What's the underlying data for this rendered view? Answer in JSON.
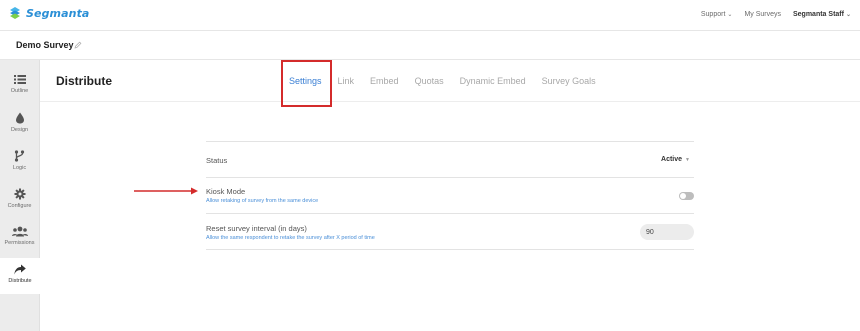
{
  "brand": {
    "name": "Segmanta",
    "accent": "#2b8fd6"
  },
  "topnav": {
    "support": "Support",
    "my_surveys": "My Surveys",
    "user": "Segmanta Staff"
  },
  "survey": {
    "title": "Demo Survey"
  },
  "sidebar": {
    "items": [
      {
        "label": "Outline",
        "icon": "list-icon"
      },
      {
        "label": "Design",
        "icon": "droplet-icon"
      },
      {
        "label": "Logic",
        "icon": "branch-icon"
      },
      {
        "label": "Configure",
        "icon": "gear-icon"
      },
      {
        "label": "Permissions",
        "icon": "users-icon"
      },
      {
        "label": "Distribute",
        "icon": "share-arrow-icon",
        "active": true
      }
    ]
  },
  "main": {
    "title": "Distribute",
    "tabs": [
      {
        "label": "Settings",
        "active": true
      },
      {
        "label": "Link"
      },
      {
        "label": "Embed"
      },
      {
        "label": "Quotas"
      },
      {
        "label": "Dynamic Embed"
      },
      {
        "label": "Survey Goals"
      }
    ]
  },
  "settings": {
    "status": {
      "label": "Status",
      "value": "Active"
    },
    "kiosk": {
      "label": "Kiosk Mode",
      "description": "Allow retaking of survey from the same device",
      "enabled": false
    },
    "reset_interval": {
      "label": "Reset survey interval (in days)",
      "description": "Allow the same respondent to retake the survey after X period of time",
      "value": "90"
    }
  },
  "colors": {
    "highlight_box": "#d42b2b",
    "active_tab": "#3a7fd4",
    "link_text": "#4a8fd8"
  }
}
